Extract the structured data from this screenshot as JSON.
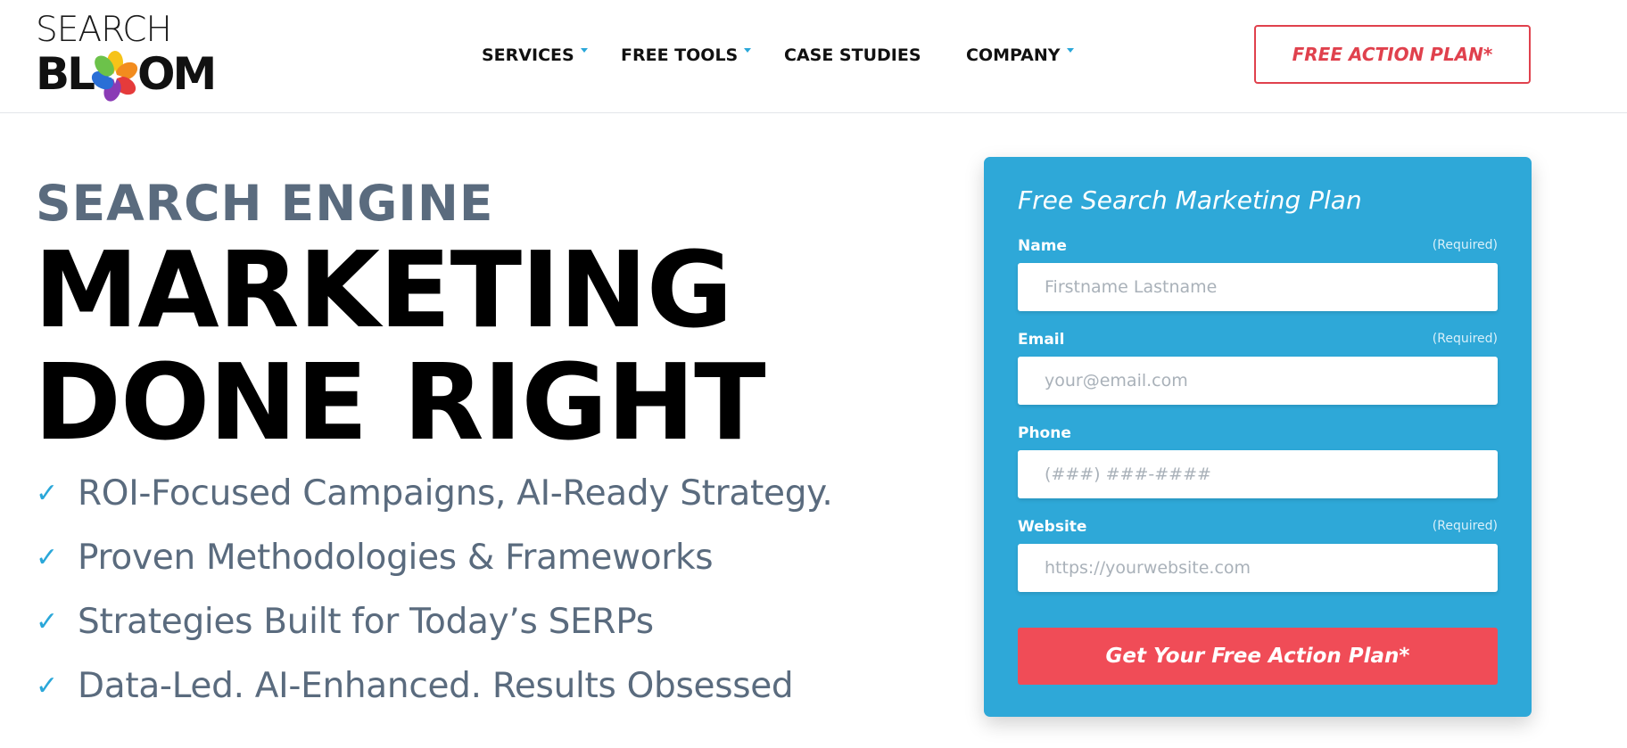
{
  "header": {
    "logo": {
      "line1": "SEARCH",
      "line2_left": "BL",
      "line2_right": "OM"
    },
    "nav": [
      {
        "label": "SERVICES",
        "has_dropdown": true
      },
      {
        "label": "FREE TOOLS",
        "has_dropdown": true
      },
      {
        "label": "CASE STUDIES",
        "has_dropdown": false
      },
      {
        "label": "COMPANY",
        "has_dropdown": true
      }
    ],
    "cta_label": "FREE ACTION PLAN*"
  },
  "hero": {
    "kicker": "SEARCH ENGINE",
    "title_line1": "MARKETING",
    "title_line2": "DONE RIGHT",
    "check_icon": "check-icon",
    "bullets": [
      "ROI-Focused Campaigns, AI-Ready Strategy.",
      "Proven Methodologies & Frameworks",
      "Strategies Built for Today’s SERPs",
      "Data-Led. AI-Enhanced. Results Obsessed"
    ]
  },
  "form": {
    "title": "Free Search Marketing Plan",
    "fields": [
      {
        "label": "Name",
        "required_label": "(Required)",
        "placeholder": "Firstname Lastname",
        "value": ""
      },
      {
        "label": "Email",
        "required_label": "(Required)",
        "placeholder": "your@email.com",
        "value": ""
      },
      {
        "label": "Phone",
        "required_label": "",
        "placeholder": "(###) ###-####",
        "value": ""
      },
      {
        "label": "Website",
        "required_label": "(Required)",
        "placeholder": "https://yourwebsite.com",
        "value": ""
      }
    ],
    "submit_label": "Get Your Free Action Plan*"
  },
  "colors": {
    "accent_blue": "#2ea8d8",
    "cta_red": "#f04c57",
    "cta_outline_red": "#e0414d",
    "heading_slate": "#5a6b7e"
  }
}
